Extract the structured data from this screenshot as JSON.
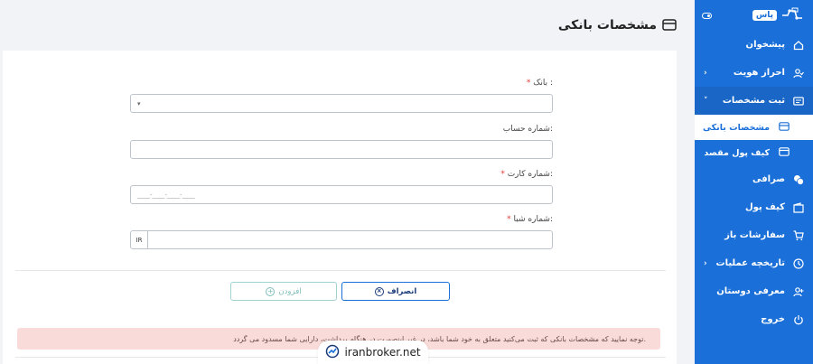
{
  "sidebar": {
    "logo_text": "پاس",
    "items": [
      {
        "label": "پیشخوان",
        "icon": "home-icon"
      },
      {
        "label": "احراز هویت",
        "icon": "user-check-icon"
      },
      {
        "label": "ثبت مشخصات",
        "icon": "id-card-icon"
      },
      {
        "label": "صرافی",
        "icon": "coins-icon"
      },
      {
        "label": "کیف پول",
        "icon": "wallet-icon"
      },
      {
        "label": "سفارشات باز",
        "icon": "cart-icon"
      },
      {
        "label": "تاریخچه عملیات",
        "icon": "clock-icon"
      },
      {
        "label": "معرفی دوستان",
        "icon": "user-plus-icon"
      },
      {
        "label": "خروج",
        "icon": "power-icon"
      }
    ],
    "subitems": [
      {
        "label": "مشخصات بانکی",
        "icon": "card-icon"
      },
      {
        "label": "کیف پول مقصد",
        "icon": "window-icon"
      }
    ]
  },
  "page": {
    "title": "مشخصات بانکی"
  },
  "form": {
    "bank_label": "بانک :",
    "account_label": "شماره حساب:",
    "card_label": "شماره کارت:",
    "card_placeholder": "____-____-____-____",
    "iban_label": "شماره شبا:",
    "iban_prefix": "IR",
    "required_mark": "*"
  },
  "buttons": {
    "cancel": "انصراف",
    "add": "افزودن"
  },
  "alert": {
    "text": "توجه نمایید که مشخصات بانکی که ثبت می‌کنید متعلق به خود شما باشد، در غیر اینصورت در هنگام برداشت، دارایی شما مسدود می گردد."
  },
  "watermark": {
    "text": "iranbroker.net"
  },
  "colors": {
    "sidebar_bg": "#1a6fd8",
    "alert_bg": "#f9dcd9",
    "required": "#e53935"
  }
}
